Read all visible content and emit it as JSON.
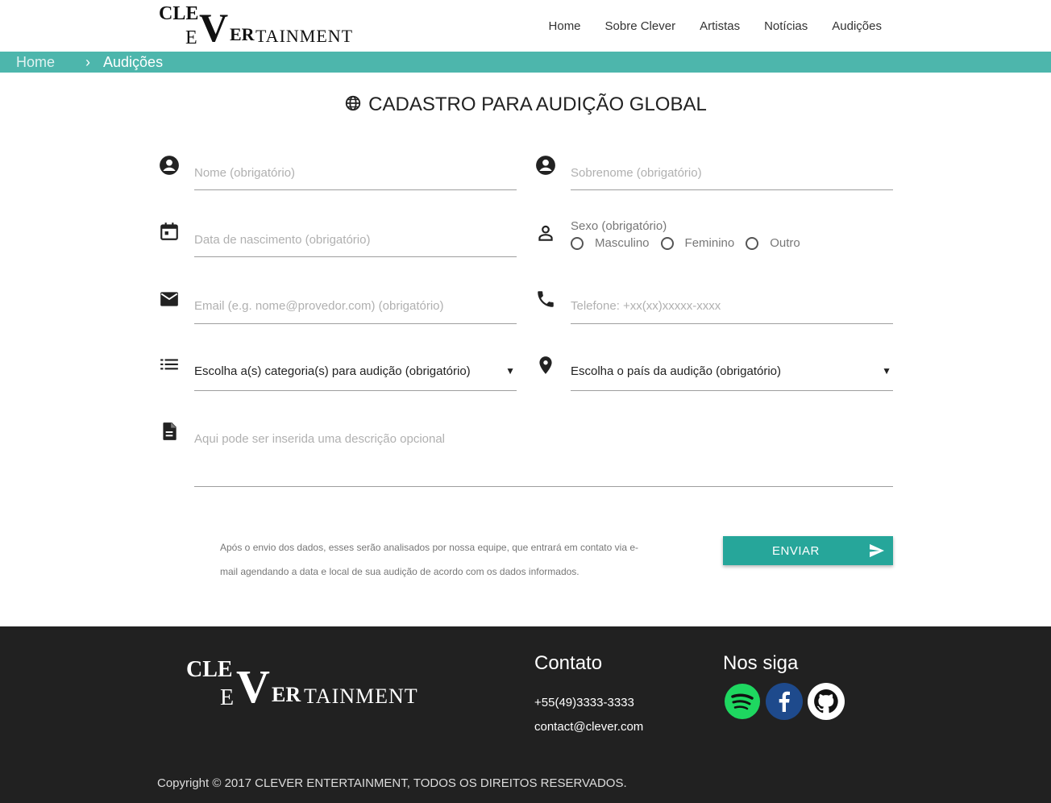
{
  "brand": {
    "logo_top": "CLE",
    "logo_v": "V",
    "logo_er": "ER",
    "logo_e": "E",
    "logo_rest": "TAINMENT"
  },
  "nav": {
    "items": [
      "Home",
      "Sobre Clever",
      "Artistas",
      "Notícias",
      "Audições"
    ]
  },
  "breadcrumb": {
    "home": "Home",
    "separator": "›",
    "current": "Audições"
  },
  "page": {
    "title": "CADASTRO PARA AUDIÇÃO GLOBAL"
  },
  "form": {
    "first_name_placeholder": "Nome (obrigatório)",
    "last_name_placeholder": "Sobrenome (obrigatório)",
    "birthdate_placeholder": "Data de nascimento (obrigatório)",
    "sex_label": "Sexo (obrigatório)",
    "sex_options": [
      "Masculino",
      "Feminino",
      "Outro"
    ],
    "email_placeholder": "Email (e.g. nome@provedor.com) (obrigatório)",
    "phone_placeholder": "Telefone: +xx(xx)xxxxx-xxxx",
    "category_select": "Escolha a(s) categoria(s) para audição (obrigatório)",
    "country_select": "Escolha o país da audição (obrigatório)",
    "description_placeholder": "Aqui pode ser inserida uma descrição opcional",
    "note_line1": "Após o envio dos dados, esses serão analisados por nossa equipe, que entrará em contato via e-",
    "note_line2": "mail agendando a data e local de sua audição de acordo com os dados informados.",
    "submit_label": "ENVIAR"
  },
  "footer": {
    "contact_title": "Contato",
    "phone": "+55(49)3333-3333",
    "email": "contact@clever.com",
    "follow_title": "Nos siga",
    "social": [
      "spotify-icon",
      "facebook-icon",
      "github-icon"
    ],
    "copyright": "Copyright © 2017 CLEVER ENTERTAINMENT, TODOS OS DIREITOS RESERVADOS."
  },
  "colors": {
    "accent": "#4db6ac",
    "button": "#26a69a",
    "footer_bg": "#212121",
    "spotify": "#1ed760",
    "facebook": "#1e4a8c"
  }
}
